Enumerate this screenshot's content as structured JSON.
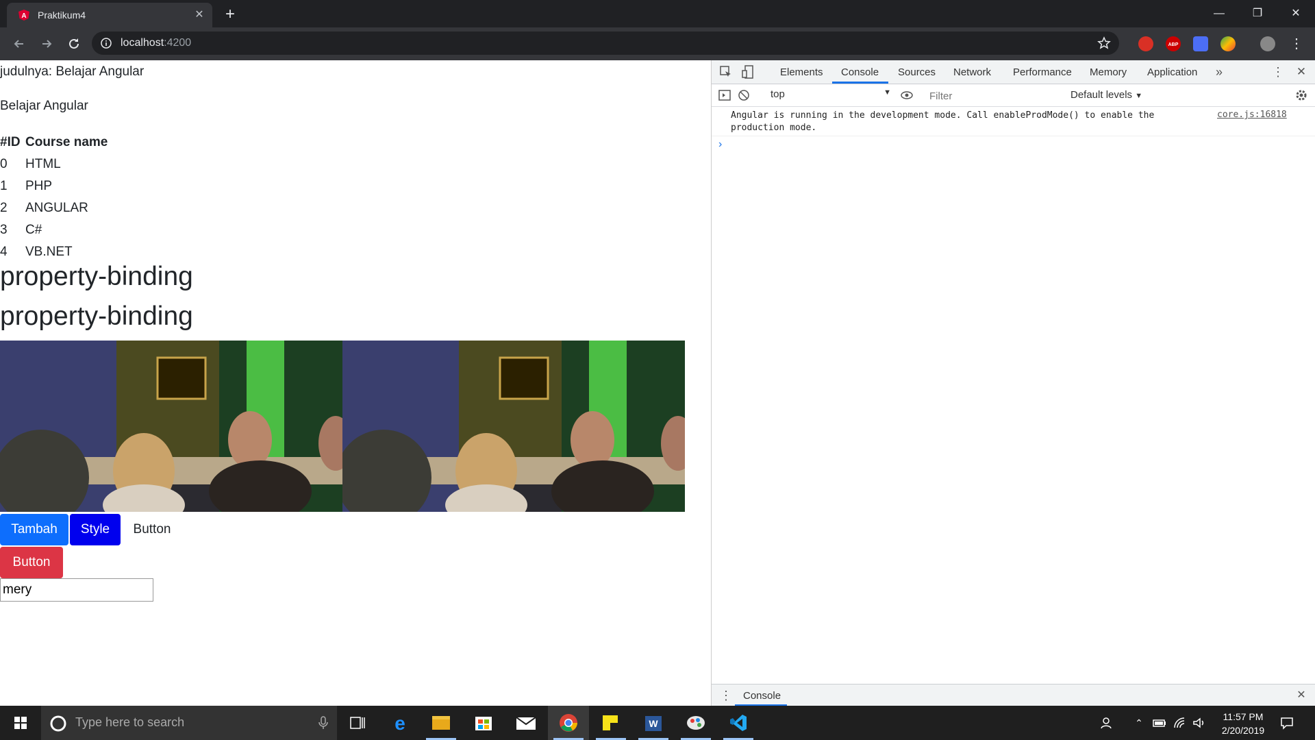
{
  "browser": {
    "tab_title": "Praktikum4",
    "url_host": "localhost",
    "url_port": ":4200"
  },
  "page": {
    "judul_text": "judulnya: Belajar Angular",
    "subtitle": "Belajar Angular",
    "table": {
      "headers": [
        "#ID",
        "Course name"
      ],
      "rows": [
        [
          "0",
          "HTML"
        ],
        [
          "1",
          "PHP"
        ],
        [
          "2",
          "ANGULAR"
        ],
        [
          "3",
          "C#"
        ],
        [
          "4",
          "VB.NET"
        ]
      ]
    },
    "heading_1": "property-binding",
    "heading_2": "property-binding",
    "buttons": {
      "tambah": "Tambah",
      "style": "Style",
      "plain": "Button",
      "danger": "Button"
    },
    "input_value": "mery"
  },
  "devtools": {
    "tabs": [
      "Elements",
      "Console",
      "Sources",
      "Network",
      "Performance",
      "Memory",
      "Application"
    ],
    "active_tab": "Console",
    "context": "top",
    "filter_placeholder": "Filter",
    "levels": "Default levels",
    "console_message": "Angular is running in the development mode. Call enableProdMode() to enable the production mode.",
    "console_source": "core.js:16818",
    "drawer_tab": "Console"
  },
  "taskbar": {
    "search_placeholder": "Type here to search",
    "time": "11:57 PM",
    "date": "2/20/2019"
  },
  "colors": {
    "tambah": "#0d6efd",
    "style": "#0000ee",
    "danger": "#dc3545",
    "accent": "#1a73e8"
  }
}
